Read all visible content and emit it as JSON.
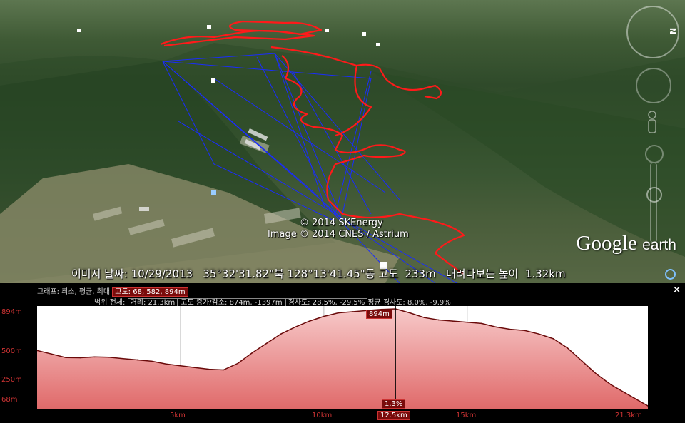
{
  "map": {
    "copyright_1": "© 2014 SKEnergy",
    "copyright_2": "Image © 2014 CNES / Astrium",
    "brand_google": "Google",
    "brand_earth": "earth",
    "status": "이미지 날짜: 10/29/2013   35°32'31.82\"북 128°13'41.45\"동 고도  233m   내려다보는 높이  1.32km",
    "compass_north": "N",
    "icons": [
      "compass-icon",
      "look-around-icon",
      "street-view-pegman-icon",
      "zoom-in-icon",
      "zoom-slider-icon",
      "status-ring-icon"
    ],
    "colors": {
      "track": "#ff1a1a",
      "lines": "#1a2cff"
    }
  },
  "profile": {
    "close": "×",
    "row1_prefix": "그래프: 최소, 평균, 최대",
    "row1_value": "고도: 68, 582, 894m",
    "row2_prefix": "범위 전체:",
    "row2_dist": "거리: 21.3km",
    "row2_gain": "고도 증가/감소: 874m, -1397m",
    "row2_slope": "경사도: 28.5%, -29.5%",
    "row2_avg": "평균 경사도: 8.0%, -9.9%",
    "y_labels": [
      "894m",
      "500m",
      "250m",
      "68m"
    ],
    "x_labels": [
      "5km",
      "10km",
      "15km",
      "21.3km"
    ],
    "cursor_distance": "12.5km",
    "cursor_elevation": "894m",
    "cursor_slope": "1.3%"
  },
  "chart_data": {
    "type": "area",
    "x_unit": "km",
    "y_unit": "m",
    "xlim": [
      0,
      21.3
    ],
    "ylim": [
      68,
      894
    ],
    "x": [
      0,
      0.5,
      1,
      1.5,
      2,
      2.5,
      3,
      3.5,
      4,
      4.5,
      5,
      5.5,
      6,
      6.5,
      7,
      7.5,
      8,
      8.5,
      9,
      9.5,
      10,
      10.5,
      11,
      11.5,
      12,
      12.5,
      13,
      13.5,
      14,
      14.5,
      15,
      15.5,
      16,
      16.5,
      17,
      17.5,
      18,
      18.5,
      19,
      19.5,
      20,
      20.5,
      21,
      21.3
    ],
    "y": [
      540,
      510,
      480,
      478,
      485,
      482,
      470,
      460,
      448,
      425,
      410,
      395,
      380,
      375,
      430,
      520,
      600,
      680,
      740,
      790,
      830,
      860,
      870,
      880,
      890,
      894,
      860,
      820,
      800,
      790,
      780,
      770,
      740,
      720,
      710,
      680,
      640,
      560,
      450,
      340,
      250,
      180,
      110,
      68
    ]
  }
}
